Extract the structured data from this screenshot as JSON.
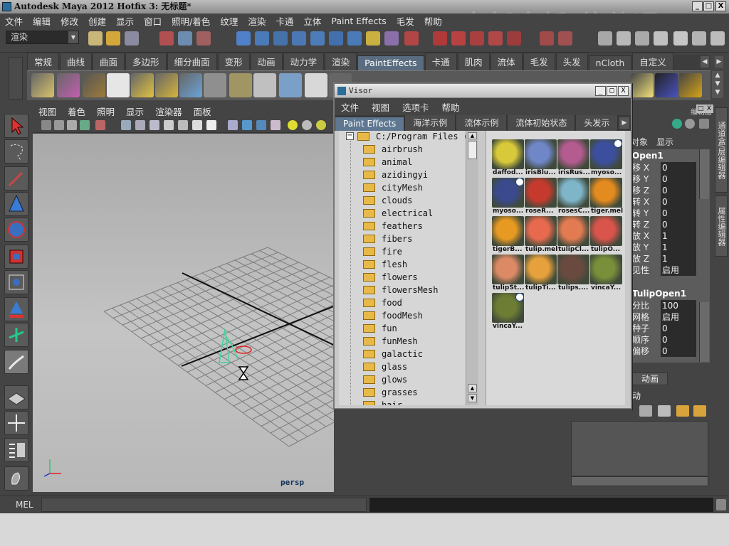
{
  "window": {
    "title": "Autodesk Maya 2012 Hotfix 3: 无标题*",
    "watermark": "中新金桥 软件通",
    "controls": [
      "_",
      "□",
      "X"
    ]
  },
  "menubar": [
    "文件",
    "编辑",
    "修改",
    "创建",
    "显示",
    "窗口",
    "照明/着色",
    "纹理",
    "渲染",
    "卡通",
    "立体",
    "Paint Effects",
    "毛发",
    "帮助"
  ],
  "statusline": {
    "mode_selector": "渲染"
  },
  "shelf": {
    "tabs": [
      "常规",
      "曲线",
      "曲面",
      "多边形",
      "细分曲面",
      "变形",
      "动画",
      "动力学",
      "渲染",
      "PaintEffects",
      "卡通",
      "肌肉",
      "流体",
      "毛发",
      "头发",
      "nCloth",
      "自定义"
    ],
    "active_tab": "PaintEffects"
  },
  "viewport": {
    "menu": [
      "视图",
      "着色",
      "照明",
      "显示",
      "渲染器",
      "面板"
    ],
    "camera_label": "persp"
  },
  "channel_box": {
    "header": "编辑器",
    "menu": [
      "对象",
      "显示"
    ],
    "object_name": "Open1",
    "attributes": [
      {
        "label": "移 X",
        "value": "0"
      },
      {
        "label": "移 Y",
        "value": "0"
      },
      {
        "label": "移 Z",
        "value": "0"
      },
      {
        "label": "转 X",
        "value": "0"
      },
      {
        "label": "转 Y",
        "value": "0"
      },
      {
        "label": "转 Z",
        "value": "0"
      },
      {
        "label": "放 X",
        "value": "1"
      },
      {
        "label": "放 Y",
        "value": "1"
      },
      {
        "label": "放 Z",
        "value": "1"
      },
      {
        "label": "见性",
        "value": "启用"
      }
    ],
    "shape_name": "TulipOpen1",
    "shape_attributes": [
      {
        "label": "分比",
        "value": "100"
      },
      {
        "label": "网格",
        "value": "启用"
      },
      {
        "label": "种子",
        "value": "0"
      },
      {
        "label": "顺序",
        "value": "0"
      },
      {
        "label": "偏移",
        "value": "0"
      }
    ],
    "layer_tab": "动画",
    "layer_label": "动",
    "side_tabs": [
      "通道盒/层编辑器",
      "属性编辑器"
    ]
  },
  "command_line": {
    "label": "MEL"
  },
  "visor": {
    "title": "Visor",
    "menu": [
      "文件",
      "视图",
      "选项卡",
      "帮助"
    ],
    "tabs": [
      "Paint Effects",
      "海洋示例",
      "流体示例",
      "流体初始状态",
      "头发示"
    ],
    "root_path": "C:/Program Files (x",
    "folders": [
      "airbrush",
      "animal",
      "azidingyi",
      "cityMesh",
      "clouds",
      "electrical",
      "feathers",
      "fibers",
      "fire",
      "flesh",
      "flowers",
      "flowersMesh",
      "food",
      "foodMesh",
      "fun",
      "funMesh",
      "galactic",
      "glass",
      "glows",
      "grasses",
      "hair"
    ],
    "presets": [
      {
        "label": "daffod...",
        "color": "#d8c93a"
      },
      {
        "label": "irisBlu...",
        "color": "#6f86c7"
      },
      {
        "label": "irisRus...",
        "color": "#b45c8f"
      },
      {
        "label": "myoso...",
        "color": "#3c4f9e"
      },
      {
        "label": "myoso...",
        "color": "#3a4a8c"
      },
      {
        "label": "roseR...",
        "color": "#c63a2e"
      },
      {
        "label": "rosesC...",
        "color": "#7fb5c9"
      },
      {
        "label": "tiger.mel",
        "color": "#e48b1f"
      },
      {
        "label": "tigerB...",
        "color": "#e79a22"
      },
      {
        "label": "tulip.mel",
        "color": "#e86a4e"
      },
      {
        "label": "tulipCl...",
        "color": "#e37b52"
      },
      {
        "label": "tulipO...",
        "color": "#d9544a"
      },
      {
        "label": "tulipSt...",
        "color": "#dc8a66"
      },
      {
        "label": "tulipTi...",
        "color": "#e7a13c"
      },
      {
        "label": "tulips....",
        "color": "#6a4a3e"
      },
      {
        "label": "vincaY...",
        "color": "#7a8f3a"
      },
      {
        "label": "vincaY...",
        "color": "#6e7d34"
      }
    ]
  }
}
